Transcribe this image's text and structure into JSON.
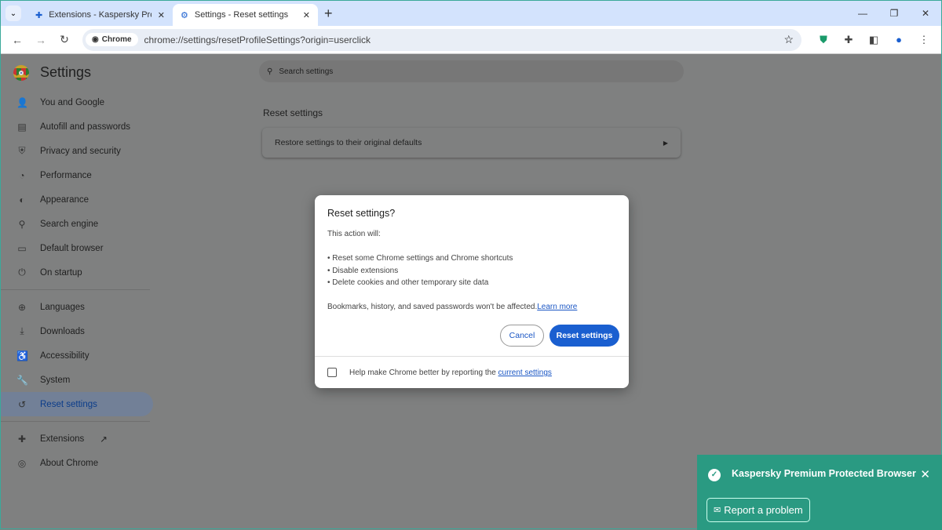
{
  "tabs": [
    {
      "label": "Extensions - Kaspersky Protection",
      "icon": "puzzle-icon"
    },
    {
      "label": "Settings - Reset settings",
      "icon": "gear-icon",
      "active": true
    }
  ],
  "omnibox": {
    "chip": "Chrome",
    "url": "chrome://settings/resetProfileSettings?origin=userclick"
  },
  "sidebar": {
    "title": "Settings",
    "items": [
      {
        "label": "You and Google",
        "icon": "👤"
      },
      {
        "label": "Autofill and passwords",
        "icon": "▤"
      },
      {
        "label": "Privacy and security",
        "icon": "⛨"
      },
      {
        "label": "Performance",
        "icon": "◔"
      },
      {
        "label": "Appearance",
        "icon": "◐"
      },
      {
        "label": "Search engine",
        "icon": "⚲"
      },
      {
        "label": "Default browser",
        "icon": "▭"
      },
      {
        "label": "On startup",
        "icon": "⏻"
      },
      {
        "label": "Languages",
        "icon": "⊕"
      },
      {
        "label": "Downloads",
        "icon": "⤓"
      },
      {
        "label": "Accessibility",
        "icon": "♿"
      },
      {
        "label": "System",
        "icon": "🔧"
      },
      {
        "label": "Reset settings",
        "icon": "↺"
      },
      {
        "label": "Extensions",
        "icon": "✚"
      },
      {
        "label": "About Chrome",
        "icon": "◎"
      }
    ]
  },
  "search": {
    "placeholder": "Search settings"
  },
  "main": {
    "section_title": "Reset settings",
    "card_label": "Restore settings to their original defaults"
  },
  "dialog": {
    "title": "Reset settings?",
    "intro": "This action will:",
    "bullets": [
      "• Reset some Chrome settings and Chrome shortcuts",
      "• Disable extensions",
      "• Delete cookies and other temporary site data"
    ],
    "note": "Bookmarks, history, and saved passwords won't be affected.",
    "learn_more": "Learn more",
    "cancel": "Cancel",
    "reset": "Reset settings",
    "checkbox_label": "Help make Chrome better by reporting the ",
    "checkbox_link": "current settings"
  },
  "toast": {
    "title": "Kaspersky Premium Protected Browser",
    "button": "Report a problem"
  }
}
